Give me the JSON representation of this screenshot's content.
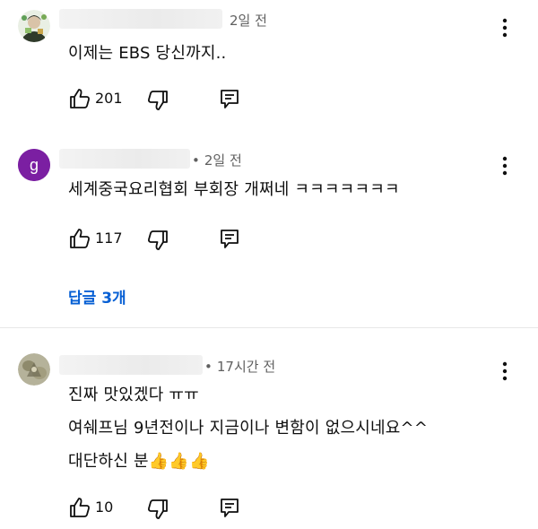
{
  "comments": [
    {
      "time": "2일 전",
      "lines": [
        "이제는 EBS 당신까지.."
      ],
      "likes": "201"
    },
    {
      "time": "2일 전",
      "avatar_letter": "g",
      "lines": [
        "세계중국요리협회 부회장 개쩌네 ㅋㅋㅋㅋㅋㅋㅋ"
      ],
      "likes": "117",
      "replies_label": "답글 3개"
    },
    {
      "time": "17시간 전",
      "lines": [
        "진짜 맛있겠다 ㅠㅠ",
        "여쉐프님 9년전이나 지금이나 변함이 없으시네요^^",
        "대단하신 분"
      ],
      "emoji": "👍👍👍",
      "likes": "10"
    }
  ],
  "colors": {
    "reply_link": "#065fd4",
    "avatar_g": "#7b1fa2",
    "meta_text": "#606060"
  },
  "icons": {
    "like": "thumbs-up-icon",
    "dislike": "thumbs-down-icon",
    "reply": "reply-icon",
    "menu": "more-vertical-icon"
  }
}
